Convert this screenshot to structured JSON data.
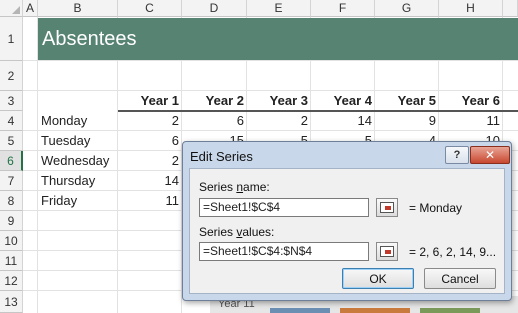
{
  "column_headers": [
    "A",
    "B",
    "C",
    "D",
    "E",
    "F",
    "G",
    "H"
  ],
  "row_headers": [
    "1",
    "2",
    "3",
    "4",
    "5",
    "6",
    "7",
    "8",
    "9",
    "10",
    "11",
    "12",
    "13"
  ],
  "selected_row": "6",
  "title": "Absentees",
  "title_color": "#578373",
  "table": {
    "year_headers": [
      "Year 1",
      "Year 2",
      "Year 3",
      "Year 4",
      "Year 5",
      "Year 6"
    ],
    "rows": [
      {
        "day": "Monday",
        "values": [
          "2",
          "6",
          "2",
          "14",
          "9",
          "11"
        ]
      },
      {
        "day": "Tuesday",
        "values": [
          "6",
          "15",
          "5",
          "5",
          "4",
          "10"
        ]
      },
      {
        "day": "Wednesday",
        "values": [
          "2"
        ]
      },
      {
        "day": "Thursday",
        "values": [
          "14"
        ]
      },
      {
        "day": "Friday",
        "values": [
          "11"
        ]
      }
    ]
  },
  "chart_peek_label": "Year 11",
  "dialog": {
    "title": "Edit Series",
    "help_label": "?",
    "close_label": "✕",
    "series_name_label_pre": "Series ",
    "series_name_label_key": "n",
    "series_name_label_post": "ame:",
    "series_name_value": "=Sheet1!$C$4",
    "series_name_preview": "= Monday",
    "series_values_label_pre": "Series ",
    "series_values_label_key": "v",
    "series_values_label_post": "alues:",
    "series_values_value": "=Sheet1!$C$4:$N$4",
    "series_values_preview": "= 2, 6, 2, 14, 9...",
    "ok_label": "OK",
    "cancel_label": "Cancel",
    "range_button_icon": "collapse-dialog-icon"
  }
}
